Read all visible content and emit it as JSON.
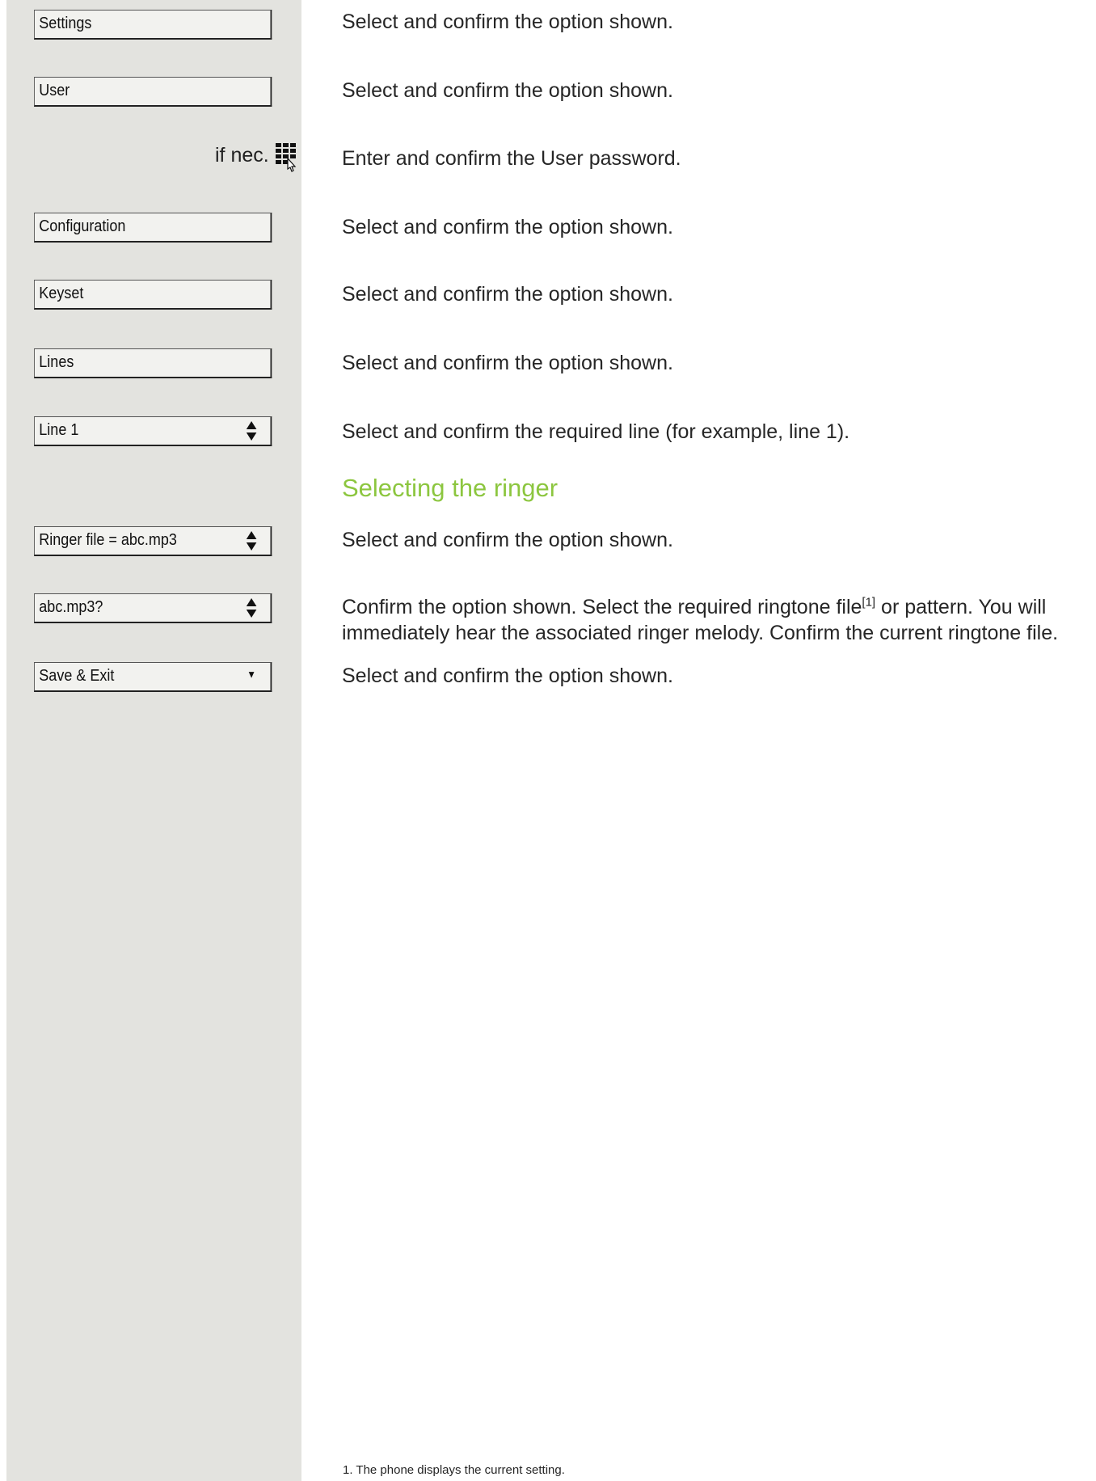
{
  "menu": {
    "settings": "Settings",
    "user": "User",
    "configuration": "Configuration",
    "keyset": "Keyset",
    "lines": "Lines",
    "line1": "Line 1",
    "ringer_file": "Ringer file = abc.mp3",
    "abc": "abc.mp3?",
    "save_exit": "Save & Exit"
  },
  "if_nec": "if nec.",
  "icons": {
    "keypad": "keypad-icon",
    "updown": "up-down-arrow-icon",
    "down": "down-arrow-icon"
  },
  "steps": {
    "settings": "Select and confirm the option shown.",
    "user": "Select and confirm the option shown.",
    "password": "Enter and confirm the User password.",
    "configuration": "Select and confirm the option shown.",
    "keyset": "Select and confirm the option shown.",
    "lines": "Select and confirm the option shown.",
    "line1": "Select and confirm the required line (for example, line 1).",
    "ringer_file": "Select and confirm the option shown.",
    "abc_part1": "Confirm the option shown. Select the required ringtone file",
    "abc_ref": "[1]",
    "abc_part2": " or pattern. You will",
    "abc_line2": "immediately hear the associated ringer melody. Confirm the current ringtone file.",
    "save_exit": "Select and confirm the option shown."
  },
  "section_heading": "Selecting the ringer",
  "footnote": "1.   The phone displays the current setting.",
  "colors": {
    "heading": "#8cc63f",
    "sidebar": "#e3e3df"
  }
}
